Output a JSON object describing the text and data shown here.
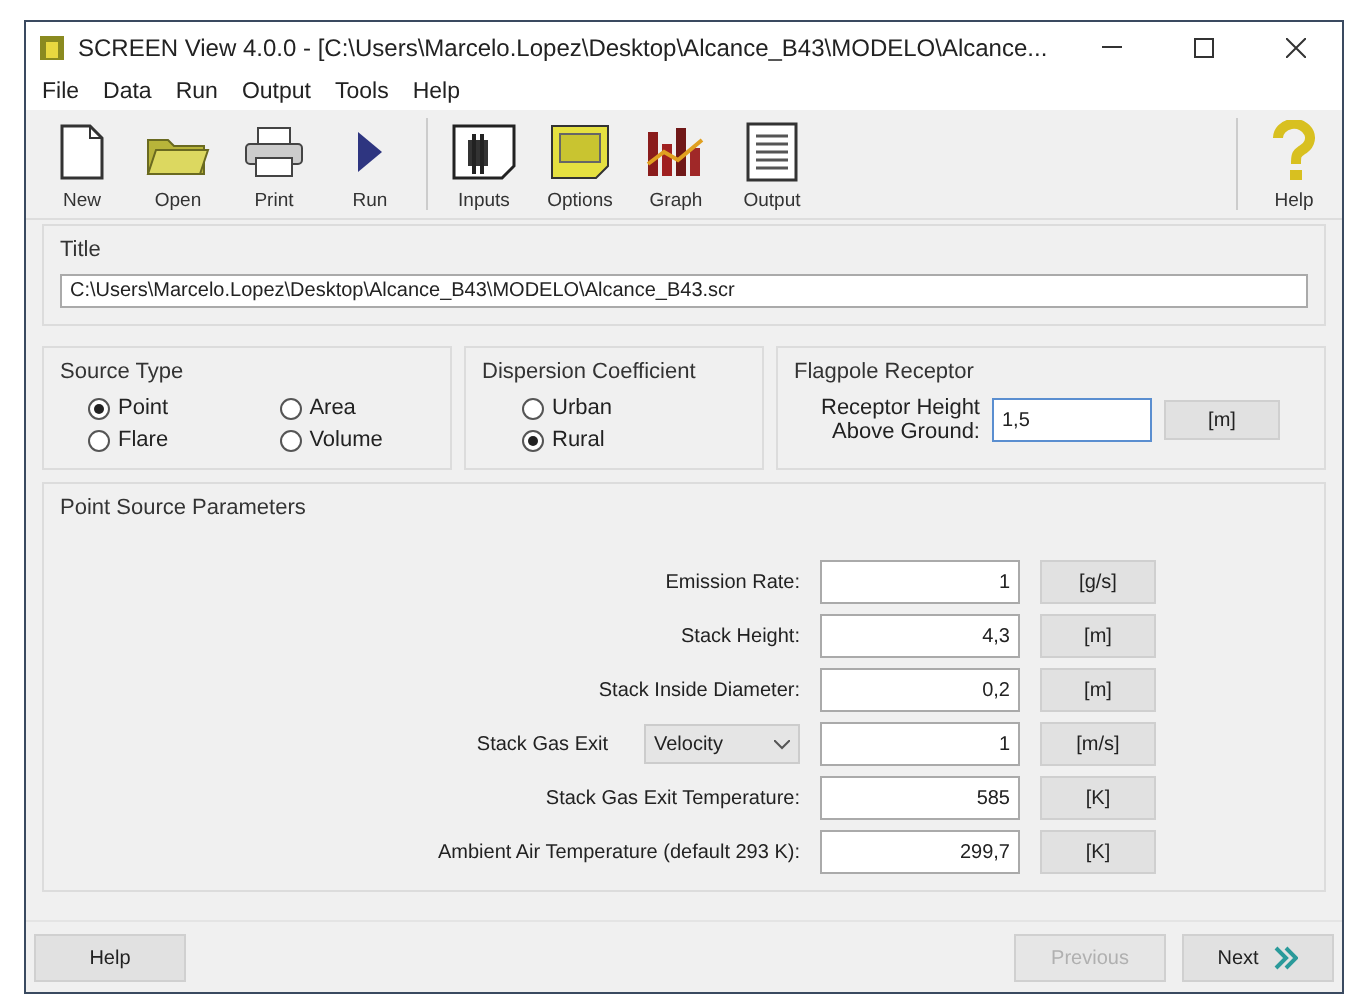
{
  "window": {
    "title": "SCREEN View 4.0.0 - [C:\\Users\\Marcelo.Lopez\\Desktop\\Alcance_B43\\MODELO\\Alcance..."
  },
  "menu": [
    "File",
    "Data",
    "Run",
    "Output",
    "Tools",
    "Help"
  ],
  "toolbar": [
    {
      "kind": "new",
      "label": "New"
    },
    {
      "kind": "open",
      "label": "Open"
    },
    {
      "kind": "print",
      "label": "Print"
    },
    {
      "kind": "run",
      "label": "Run"
    },
    {
      "kind": "inputs",
      "label": "Inputs"
    },
    {
      "kind": "options",
      "label": "Options"
    },
    {
      "kind": "graph",
      "label": "Graph"
    },
    {
      "kind": "output",
      "label": "Output"
    },
    {
      "kind": "help",
      "label": "Help"
    }
  ],
  "title_group": {
    "label": "Title",
    "value": "C:\\Users\\Marcelo.Lopez\\Desktop\\Alcance_B43\\MODELO\\Alcance_B43.scr"
  },
  "source_type": {
    "label": "Source Type",
    "options": [
      {
        "label": "Point",
        "selected": true
      },
      {
        "label": "Area",
        "selected": false
      },
      {
        "label": "Flare",
        "selected": false
      },
      {
        "label": "Volume",
        "selected": false
      }
    ]
  },
  "dispersion": {
    "label": "Dispersion Coefficient",
    "options": [
      {
        "label": "Urban",
        "selected": false
      },
      {
        "label": "Rural",
        "selected": true
      }
    ]
  },
  "flagpole": {
    "label": "Flagpole Receptor",
    "field_label": "Receptor Height Above Ground:",
    "value": "1,5",
    "unit": "[m]"
  },
  "point_source": {
    "label": "Point Source Parameters",
    "rows": [
      {
        "label": "Emission Rate:",
        "value": "1",
        "unit": "[g/s]"
      },
      {
        "label": "Stack Height:",
        "value": "4,3",
        "unit": "[m]"
      },
      {
        "label": "Stack Inside Diameter:",
        "value": "0,2",
        "unit": "[m]"
      },
      {
        "label": "Stack Gas Exit",
        "dropdown": "Velocity",
        "value": "1",
        "unit": "[m/s]"
      },
      {
        "label": "Stack Gas Exit Temperature:",
        "value": "585",
        "unit": "[K]"
      },
      {
        "label": "Ambient Air Temperature (default 293 K):",
        "value": "299,7",
        "unit": "[K]"
      }
    ]
  },
  "footer": {
    "help": "Help",
    "previous": {
      "label": "Previous",
      "disabled": true
    },
    "next": {
      "label": "Next",
      "disabled": false
    }
  }
}
